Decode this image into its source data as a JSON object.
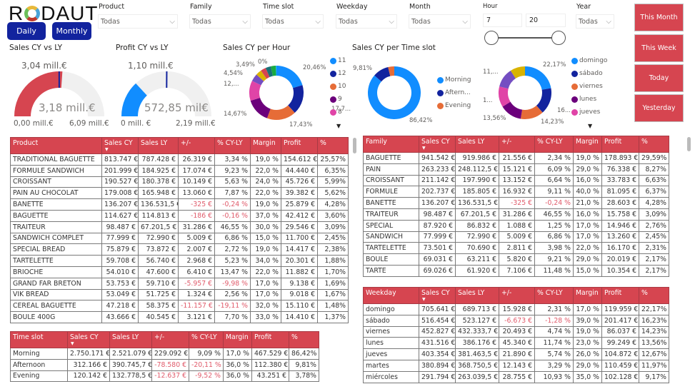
{
  "header": {
    "logo": "RODAUT",
    "daily_label": "Daily",
    "monthly_label": "Monthly"
  },
  "filters": {
    "product": {
      "label": "Product",
      "value": "Todas"
    },
    "family": {
      "label": "Family",
      "value": "Todas"
    },
    "time_slot": {
      "label": "Time slot",
      "value": "Todas"
    },
    "weekday": {
      "label": "Weekday",
      "value": "Todas"
    },
    "month": {
      "label": "Month",
      "value": "Todas"
    },
    "hour": {
      "label": "Hour",
      "min": "7",
      "max": "20"
    },
    "year": {
      "label": "Year",
      "value": "Todas"
    }
  },
  "quick_buttons": [
    "This Month",
    "This Week",
    "Today",
    "Yesterday"
  ],
  "gauges": [
    {
      "title": "Sales CY vs LY",
      "value": "3,18 mill.€",
      "target": "3,04 mill.€",
      "min": "0,00 mill.€",
      "max": "6,09 mill.€",
      "value_num": 3.18,
      "target_num": 3.04,
      "max_num": 6.09,
      "color": "#D64550"
    },
    {
      "title": "Profit CY vs LY",
      "value": "572,85 mil€",
      "target": "1,10 mill.€",
      "min": "0 mill. €",
      "max": "2,19 mill.€",
      "value_num": 0.57285,
      "target_num": 1.1,
      "max_num": 2.19,
      "color": "#118DFF"
    }
  ],
  "chart_data": [
    {
      "type": "pie",
      "title": "Sales CY per Hour",
      "legend": [
        "11",
        "12",
        "10",
        "9",
        "8"
      ],
      "slices": [
        {
          "name": "11",
          "value": 20.46,
          "label": "20,46%",
          "color": "#118DFF"
        },
        {
          "name": "12",
          "value": 17.7,
          "label": "17,7...",
          "color": "#12239E"
        },
        {
          "name": "10",
          "value": 17.43,
          "label": "17,43%",
          "color": "#E66C37"
        },
        {
          "name": "9",
          "value": 14.67,
          "label": "14,67%",
          "color": "#6B007B"
        },
        {
          "name": "8",
          "value": 12.0,
          "label": "12,...",
          "color": "#E044A7"
        },
        {
          "value": 4.54,
          "label": "4,54%",
          "color": "#744EC2"
        },
        {
          "value": 3.49,
          "label": "3,49%",
          "color": "#D9B300"
        },
        {
          "value": 3.2,
          "color": "#D64550"
        },
        {
          "value": 3.2,
          "color": "#197278"
        },
        {
          "value": 3.0,
          "color": "#1AAB40"
        },
        {
          "value": 0.3,
          "label": "0%",
          "color": "#15C6F4"
        }
      ]
    },
    {
      "type": "pie",
      "title": "Sales CY per Time slot",
      "legend": [
        "Morning",
        "Aftern...",
        "Evening"
      ],
      "slices": [
        {
          "name": "Morning",
          "value": 86.42,
          "label": "86,42%",
          "color": "#118DFF"
        },
        {
          "name": "Afternoon",
          "value": 9.81,
          "label": "9,81%",
          "color": "#12239E"
        },
        {
          "name": "Evening",
          "value": 3.78,
          "color": "#E66C37"
        }
      ]
    },
    {
      "type": "pie",
      "title": "",
      "legend": [
        "domingo",
        "sábado",
        "viernes",
        "lunes",
        "jueves"
      ],
      "slices": [
        {
          "name": "domingo",
          "value": 22.17,
          "label": "22,17%",
          "color": "#118DFF"
        },
        {
          "name": "sábado",
          "value": 16.23,
          "label": "16...",
          "color": "#12239E"
        },
        {
          "name": "viernes",
          "value": 14.23,
          "label": "14,23%",
          "color": "#E66C37"
        },
        {
          "name": "lunes",
          "value": 13.56,
          "label": "13,56%",
          "color": "#6B007B"
        },
        {
          "name": "jueves",
          "value": 12.67,
          "label": "1...",
          "color": "#E044A7"
        },
        {
          "name": "martes",
          "value": 11.97,
          "label": "11,...",
          "color": "#744EC2"
        },
        {
          "name": "miércoles",
          "value": 9.17,
          "color": "#D9B300"
        }
      ]
    }
  ],
  "tables": {
    "product": {
      "headers": [
        "Product",
        "Sales CY",
        "Sales LY",
        "+/-",
        "% CY-LY",
        "Margin",
        "Profit",
        "%"
      ],
      "rows": [
        [
          "TRADITIONAL BAGUETTE",
          "813.747 €",
          "787.428 €",
          "26.319 €",
          "3,34 %",
          "19,0 %",
          "154.612 €",
          "25,57%"
        ],
        [
          "FORMULE SANDWICH",
          "201.999 €",
          "184.925 €",
          "17.074 €",
          "9,23 %",
          "22,0 %",
          "44.440 €",
          "6,35%"
        ],
        [
          "CROISSANT",
          "190.527 €",
          "180.378 €",
          "10.149 €",
          "5,63 %",
          "24,0 %",
          "45.726 €",
          "5,99%"
        ],
        [
          "PAIN AU CHOCOLAT",
          "179.008 €",
          "165.948 €",
          "13.060 €",
          "7,87 %",
          "22,0 %",
          "39.382 €",
          "5,62%"
        ],
        [
          "BANETTE",
          "136.207 €",
          "136.531,5 €",
          "-325 €",
          "-0,24 %",
          "19,0 %",
          "25.879 €",
          "4,28%"
        ],
        [
          "BAGUETTE",
          "114.627 €",
          "114.813 €",
          "-186 €",
          "-0,16 %",
          "37,0 %",
          "42.412 €",
          "3,60%"
        ],
        [
          "TRAITEUR",
          "98.487 €",
          "67.201,5 €",
          "31.286 €",
          "46,55 %",
          "30,0 %",
          "29.546 €",
          "3,09%"
        ],
        [
          "SANDWICH COMPLET",
          "77.999 €",
          "72.990 €",
          "5.009 €",
          "6,86 %",
          "15,0 %",
          "11.700 €",
          "2,45%"
        ],
        [
          "SPECIAL BREAD",
          "75.879 €",
          "73.872 €",
          "2.007 €",
          "2,72 %",
          "19,0 %",
          "14.417 €",
          "2,38%"
        ],
        [
          "TARTELETTE",
          "59.708 €",
          "56.740 €",
          "2.968 €",
          "5,23 %",
          "34,0 %",
          "20.301 €",
          "1,88%"
        ],
        [
          "BRIOCHE",
          "54.010 €",
          "47.600 €",
          "6.410 €",
          "13,47 %",
          "22,0 %",
          "11.882 €",
          "1,70%"
        ],
        [
          "GRAND FAR BRETON",
          "53.753 €",
          "59.710 €",
          "-5.957 €",
          "-9,98 %",
          "17,0 %",
          "9.138 €",
          "1,69%"
        ],
        [
          "VIK BREAD",
          "53.049 €",
          "51.725 €",
          "1.324 €",
          "2,56 %",
          "17,0 %",
          "9.018 €",
          "1,67%"
        ],
        [
          "CEREAL BAGUETTE",
          "47.218 €",
          "58.375 €",
          "-11.157 €",
          "-19,11 %",
          "32,0 %",
          "15.110 €",
          "1,48%"
        ],
        [
          "BOULE 400G",
          "43.666 €",
          "40.545 €",
          "3.121 €",
          "7,70 %",
          "33,0 %",
          "14.410 €",
          "1,37%"
        ]
      ]
    },
    "time_slot": {
      "headers": [
        "Time slot",
        "Sales CY",
        "Sales LY",
        "+/-",
        "% CY-LY",
        "Margin",
        "Profit",
        "%"
      ],
      "rows": [
        [
          "Morning",
          "2.750.171 €",
          "2.521.079 €",
          "229.092 €",
          "9,09 %",
          "17,0 %",
          "467.529 €",
          "86,42%"
        ],
        [
          "Afternoon",
          "312.166 €",
          "390.745,7 €",
          "-78.580 €",
          "-20,11 %",
          "36,0 %",
          "112.380 €",
          "9,81%"
        ],
        [
          "Evening",
          "120.142 €",
          "132.778,5 €",
          "-12.637 €",
          "-9,52 %",
          "36,0 %",
          "43.251 €",
          "3,78%"
        ]
      ]
    },
    "family": {
      "headers": [
        "Family",
        "Sales CY",
        "Sales LY",
        "+/-",
        "% CY-LY",
        "Margin",
        "Profit",
        "%"
      ],
      "rows": [
        [
          "BAGUETTE",
          "941.542 €",
          "919.986 €",
          "21.556 €",
          "2,34 %",
          "19,0 %",
          "178.893 €",
          "29,59%"
        ],
        [
          "PAIN",
          "263.233 €",
          "248.112,5 €",
          "15.121 €",
          "6,09 %",
          "29,0 %",
          "76.338 €",
          "8,27%"
        ],
        [
          "CROISSANT",
          "211.142 €",
          "197.990 €",
          "13.152 €",
          "6,64 %",
          "16,0 %",
          "33.783 €",
          "6,63%"
        ],
        [
          "FORMULE",
          "202.737 €",
          "185.805 €",
          "16.932 €",
          "9,11 %",
          "40,0 %",
          "81.095 €",
          "6,37%"
        ],
        [
          "BANETTE",
          "136.207 €",
          "136.531,5 €",
          "-325 €",
          "-0,24 %",
          "21,0 %",
          "28.603 €",
          "4,28%"
        ],
        [
          "TRAITEUR",
          "98.487 €",
          "67.201,5 €",
          "31.286 €",
          "46,55 %",
          "16,0 %",
          "15.758 €",
          "3,09%"
        ],
        [
          "SPECIAL",
          "87.920 €",
          "86.832 €",
          "1.088 €",
          "1,25 %",
          "17,0 %",
          "14.946 €",
          "2,76%"
        ],
        [
          "SANDWICH",
          "77.999 €",
          "72.990 €",
          "5.009 €",
          "6,86 %",
          "17,0 %",
          "13.260 €",
          "2,45%"
        ],
        [
          "TARTELETTE",
          "73.501 €",
          "70.690 €",
          "2.811 €",
          "3,98 %",
          "22,0 %",
          "16.170 €",
          "2,31%"
        ],
        [
          "BOULE",
          "69.031 €",
          "63.211 €",
          "5.820 €",
          "9,21 %",
          "29,0 %",
          "20.019 €",
          "2,17%"
        ],
        [
          "TARTE",
          "69.026 €",
          "61.920 €",
          "7.106 €",
          "11,48 %",
          "15,0 %",
          "10.354 €",
          "2,17%"
        ]
      ]
    },
    "weekday": {
      "headers": [
        "Weekday",
        "Sales CY",
        "Sales LY",
        "+/-",
        "% CY-LY",
        "Margin",
        "Profit",
        "%"
      ],
      "rows": [
        [
          "domingo",
          "705.641 €",
          "689.713 €",
          "15.928 €",
          "2,31 %",
          "17,0 %",
          "119.959 €",
          "22,17%"
        ],
        [
          "sábado",
          "516.454 €",
          "523.127 €",
          "-6.673 €",
          "-1,28 %",
          "39,0 %",
          "201.417 €",
          "16,23%"
        ],
        [
          "viernes",
          "452.827 €",
          "432.333,7 €",
          "20.493 €",
          "4,74 %",
          "19,0 %",
          "86.037 €",
          "14,23%"
        ],
        [
          "lunes",
          "431.516 €",
          "386.176 €",
          "45.340 €",
          "11,74 %",
          "23,0 %",
          "99.249 €",
          "13,56%"
        ],
        [
          "jueves",
          "403.354 €",
          "381.463,5 €",
          "21.890 €",
          "5,74 %",
          "26,0 %",
          "104.872 €",
          "12,67%"
        ],
        [
          "martes",
          "380.894 €",
          "368.750,5 €",
          "12.143 €",
          "3,29 %",
          "29,0 %",
          "110.459 €",
          "11,97%"
        ],
        [
          "miércoles",
          "291.794 €",
          "263.039,5 €",
          "28.755 €",
          "10,93 %",
          "35,0 %",
          "102.128 €",
          "9,17%"
        ]
      ]
    }
  }
}
